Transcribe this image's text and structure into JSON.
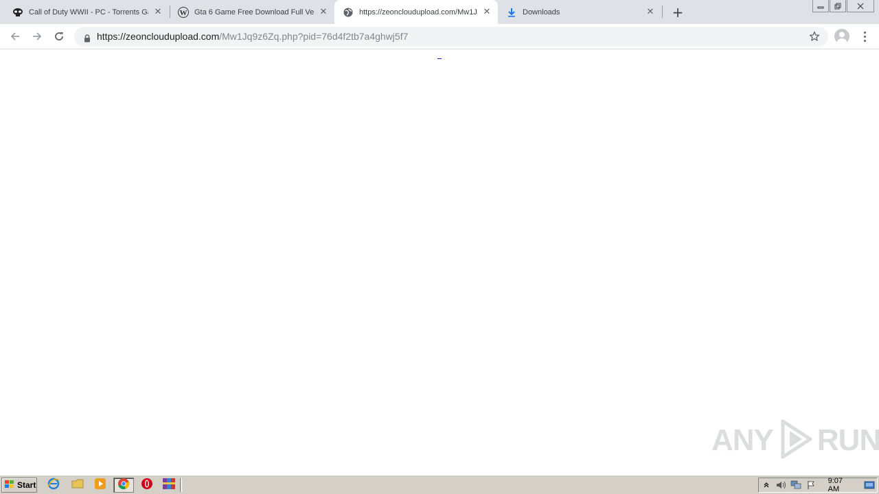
{
  "browser": {
    "tabs": [
      {
        "title": "Call of Duty WWII - PC - Torrents Ga",
        "icon": "skull-icon",
        "active": false
      },
      {
        "title": "Gta 6 Game Free Download Full Versi",
        "icon": "w-logo-icon",
        "active": false
      },
      {
        "title": "https://zeoncloudupload.com/Mw1Jq",
        "icon": "globe-icon",
        "active": true
      },
      {
        "title": "Downloads",
        "icon": "download-icon",
        "active": false
      }
    ],
    "address_bar": {
      "host": "https://zeoncloudupload.com",
      "path": "/Mw1Jq9z6Zq.php?pid=76d4f2tb7a4ghwj5f7"
    }
  },
  "page": {
    "link_text": "..."
  },
  "watermark": {
    "text_left": "ANY",
    "text_right": "RUN"
  },
  "taskbar": {
    "start_label": "Start",
    "clock": "9:07 AM"
  },
  "colors": {
    "tabstrip_bg": "#dee1e6",
    "download_blue": "#1a73e8",
    "taskbar_bg": "#d4d0c8"
  }
}
